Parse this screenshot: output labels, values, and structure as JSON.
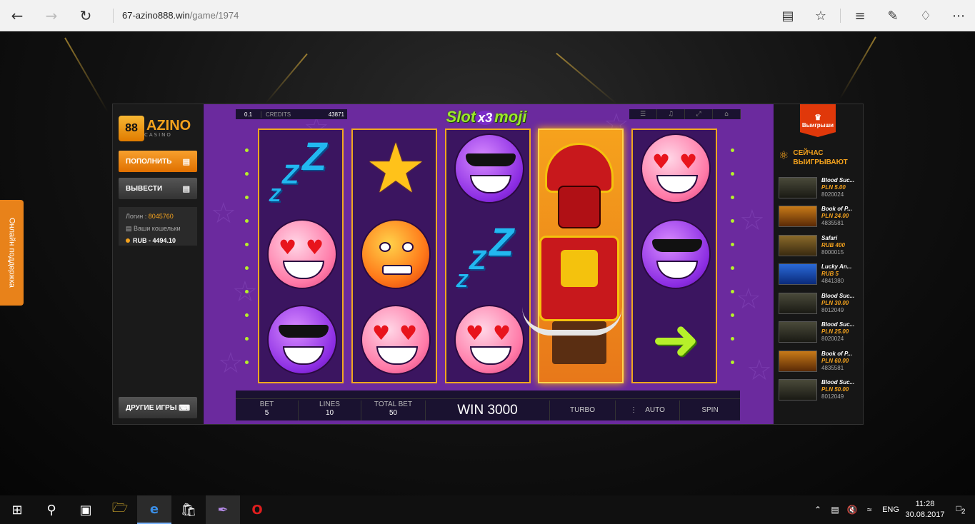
{
  "browser": {
    "url_host": "67-azino888.win",
    "url_path": "/game/1974"
  },
  "support_tab": "Онлайн поддержка",
  "casino": {
    "logo_text": "AZINO",
    "logo_sub": "CASINO",
    "logo_badge": "88",
    "deposit_button": "ПОПОЛНИТЬ",
    "withdraw_button": "ВЫВЕСТИ",
    "login_label": "Логин :",
    "login_value": "8045760",
    "wallets_label": "Ваши кошельки",
    "balance": "RUB - 4494.10",
    "other_games_button": "ДРУГИЕ ИГРЫ"
  },
  "game": {
    "title": "Slot",
    "title_mid": "x3",
    "title_end": "moji",
    "denom": "0.1",
    "credits_label": "CREDITS",
    "credits_value": "43871",
    "bet_label": "BET",
    "bet_value": "5",
    "lines_label": "LINES",
    "lines_value": "10",
    "total_bet_label": "TOTAL BET",
    "total_bet_value": "50",
    "win_text": "WIN 3000",
    "turbo": "TURBO",
    "auto": "AUTO",
    "spin": "SPIN"
  },
  "winners": {
    "badge": "Выигрыши",
    "heading_1": "СЕЙЧАС",
    "heading_2": "ВЫИГРЫВАЮТ",
    "items": [
      {
        "game": "Blood Suc...",
        "amount": "PLN 5.00",
        "user": "8020024"
      },
      {
        "game": "Book of P...",
        "amount": "PLN 24.00",
        "user": "4835581"
      },
      {
        "game": "Safari",
        "amount": "RUB 400",
        "user": "8000015"
      },
      {
        "game": "Lucky An...",
        "amount": "RUB 5",
        "user": "4841380"
      },
      {
        "game": "Blood Suc...",
        "amount": "PLN 30.00",
        "user": "8012049"
      },
      {
        "game": "Blood Suc...",
        "amount": "PLN 25.00",
        "user": "8020024"
      },
      {
        "game": "Book of P...",
        "amount": "PLN 60.00",
        "user": "4835581"
      },
      {
        "game": "Blood Suc...",
        "amount": "PLN 50.00",
        "user": "8012049"
      }
    ]
  },
  "taskbar": {
    "lang": "ENG",
    "time": "11:28",
    "date": "30.08.2017",
    "notif_count": "2"
  }
}
